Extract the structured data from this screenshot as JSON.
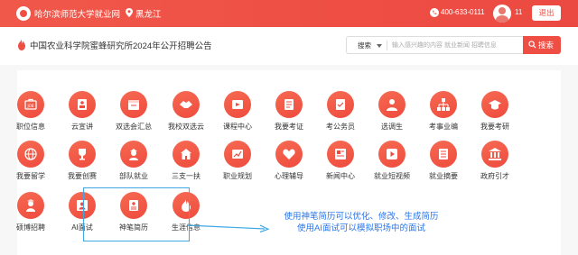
{
  "header": {
    "site_title": "哈尔滨师范大学就业网",
    "region": "黑龙江",
    "phone": "400-633-0111",
    "user_count": "11",
    "logout_label": "退出"
  },
  "notice": {
    "text": "中国农业科学院蜜蜂研究所2024年公开招聘公告"
  },
  "search": {
    "type_label": "搜索",
    "placeholder": "输入感兴趣的内容 就业新闻 招聘信息",
    "button_label": "搜索"
  },
  "services": [
    {
      "label": "职位信息",
      "icon": "job-icon"
    },
    {
      "label": "云宣讲",
      "icon": "presenter-icon"
    },
    {
      "label": "双选会汇总",
      "icon": "calendar-icon"
    },
    {
      "label": "我校双选云",
      "icon": "handshake-icon"
    },
    {
      "label": "课程中心",
      "icon": "course-icon"
    },
    {
      "label": "我要考证",
      "icon": "certificate-icon"
    },
    {
      "label": "考公务员",
      "icon": "exam-doc-icon"
    },
    {
      "label": "选调生",
      "icon": "official-icon"
    },
    {
      "label": "考事业编",
      "icon": "org-chart-icon"
    },
    {
      "label": "我要考研",
      "icon": "graduate-cap-icon"
    },
    {
      "label": "我要留学",
      "icon": "globe-icon"
    },
    {
      "label": "我要创赛",
      "icon": "trophy-icon"
    },
    {
      "label": "部队就业",
      "icon": "soldier-icon"
    },
    {
      "label": "三支一扶",
      "icon": "rural-icon"
    },
    {
      "label": "职业规划",
      "icon": "plan-icon"
    },
    {
      "label": "心理辅导",
      "icon": "heart-icon"
    },
    {
      "label": "新闻中心",
      "icon": "news-icon"
    },
    {
      "label": "就业短视频",
      "icon": "video-icon"
    },
    {
      "label": "就业摘要",
      "icon": "summary-icon"
    },
    {
      "label": "政府引才",
      "icon": "government-icon"
    },
    {
      "label": "硕博招聘",
      "icon": "doctoral-icon"
    },
    {
      "label": "AI面试",
      "icon": "ai-interview-icon"
    },
    {
      "label": "神笔简历",
      "icon": "resume-icon"
    },
    {
      "label": "生涯信息",
      "icon": "flame-icon"
    }
  ],
  "annotation": {
    "line1": "使用神笔简历可以优化、修改、生成简历",
    "line2": "使用AI面试可以模拟职场中的面试"
  },
  "colors": {
    "brand": "#ee4e44",
    "annotation": "#2a76e8",
    "highlight_border": "#3fa7e6"
  }
}
